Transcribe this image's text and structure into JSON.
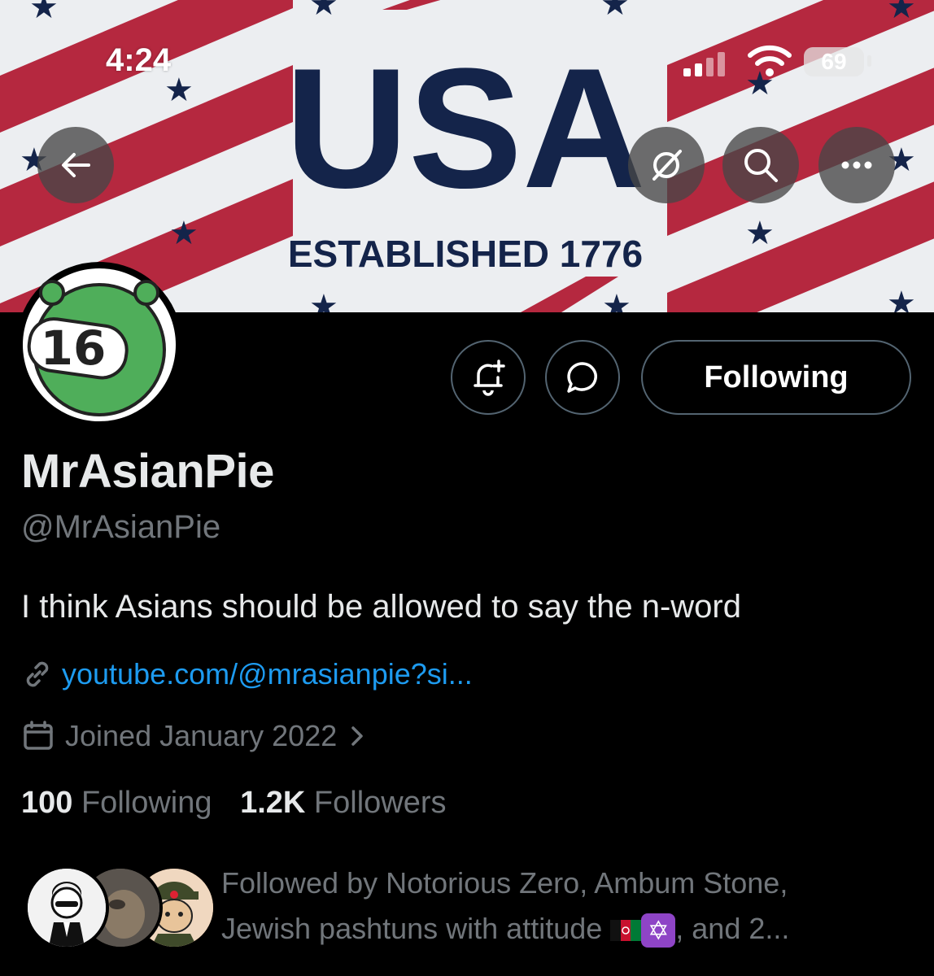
{
  "status_bar": {
    "time": "4:24",
    "battery": "69"
  },
  "banner": {
    "title": "USA",
    "subtitle": "ESTABLISHED 1776"
  },
  "actions": {
    "following_label": "Following"
  },
  "profile": {
    "display_name": "MrAsianPie",
    "handle": "@MrAsianPie",
    "bio": "I think Asians should be allowed to say the n-word",
    "link": "youtube.com/@mrasianpie?si...",
    "joined": "Joined January 2022",
    "avatar_text": "16"
  },
  "stats": {
    "following_count": "100",
    "following_label": "Following",
    "followers_count": "1.2K",
    "followers_label": "Followers"
  },
  "followed_by": {
    "prefix": "Followed by Notorious Zero, Ambum Stone,",
    "line2": "Jewish pashtuns with attitude",
    "suffix": ", and 2..."
  },
  "icons": [
    "back-arrow-icon",
    "grok-icon",
    "search-icon",
    "more-icon",
    "notification-add-icon",
    "message-icon",
    "link-icon",
    "calendar-icon",
    "chevron-right-icon"
  ],
  "colors": {
    "accent": "#1d9bf0",
    "muted": "#71767b",
    "banner_red": "#b5283f",
    "banner_navy": "#14244a"
  }
}
